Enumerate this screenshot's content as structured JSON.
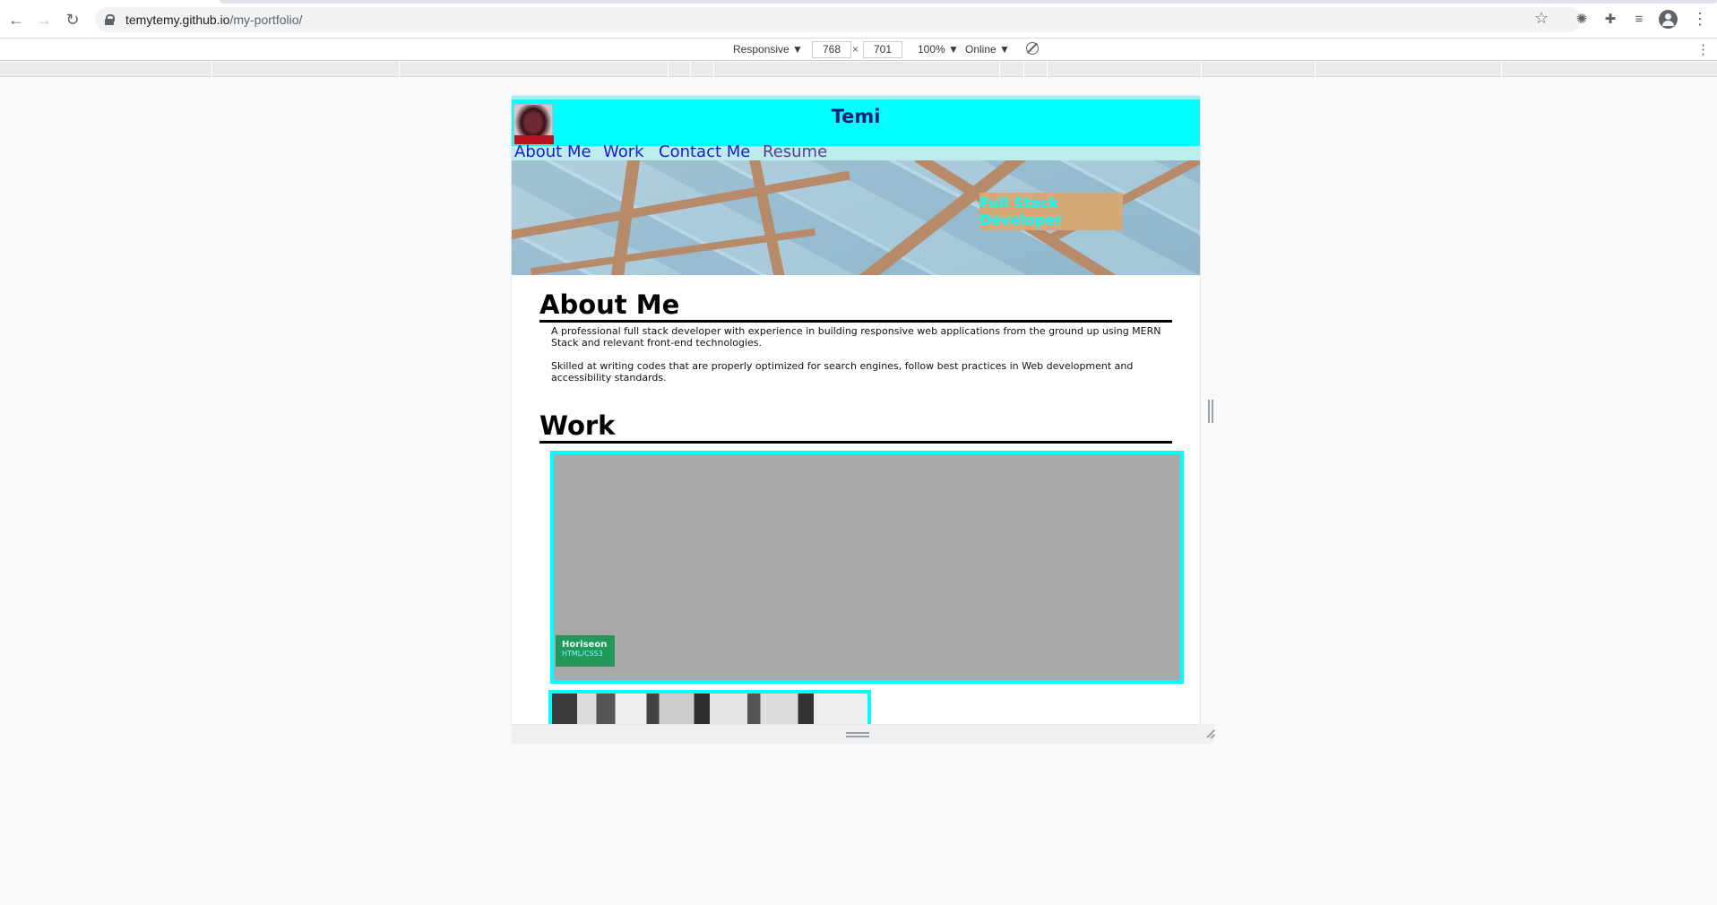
{
  "browser": {
    "url_host": "temytemy.github.io",
    "url_path": "/my-portfolio/"
  },
  "devtools": {
    "device": "Responsive ▼",
    "width": "768",
    "separator": "×",
    "height": "701",
    "zoom": "100% ▼",
    "network": "Online ▼"
  },
  "site": {
    "title": "Temi",
    "nav": [
      {
        "label": "About Me"
      },
      {
        "label": "Work"
      },
      {
        "label": "Contact Me"
      },
      {
        "label": "Resume"
      }
    ],
    "hero_badge": "Full Stack Developer",
    "about": {
      "heading": "About Me",
      "paragraph1": "A professional full stack developer with experience in building responsive web applications from the ground up using MERN Stack and relevant front-end technologies.",
      "paragraph2": "Skilled at writing codes that are properly optimized for search engines, follow best practices in Web development and accessibility standards."
    },
    "work": {
      "heading": "Work",
      "projects": [
        {
          "name": "Horiseon",
          "tech": "HTML/CSS3"
        }
      ]
    }
  },
  "colors": {
    "header": "#00ffff",
    "accent": "#00ffff",
    "badge": "#d7a877",
    "card_label": "#24975a"
  }
}
